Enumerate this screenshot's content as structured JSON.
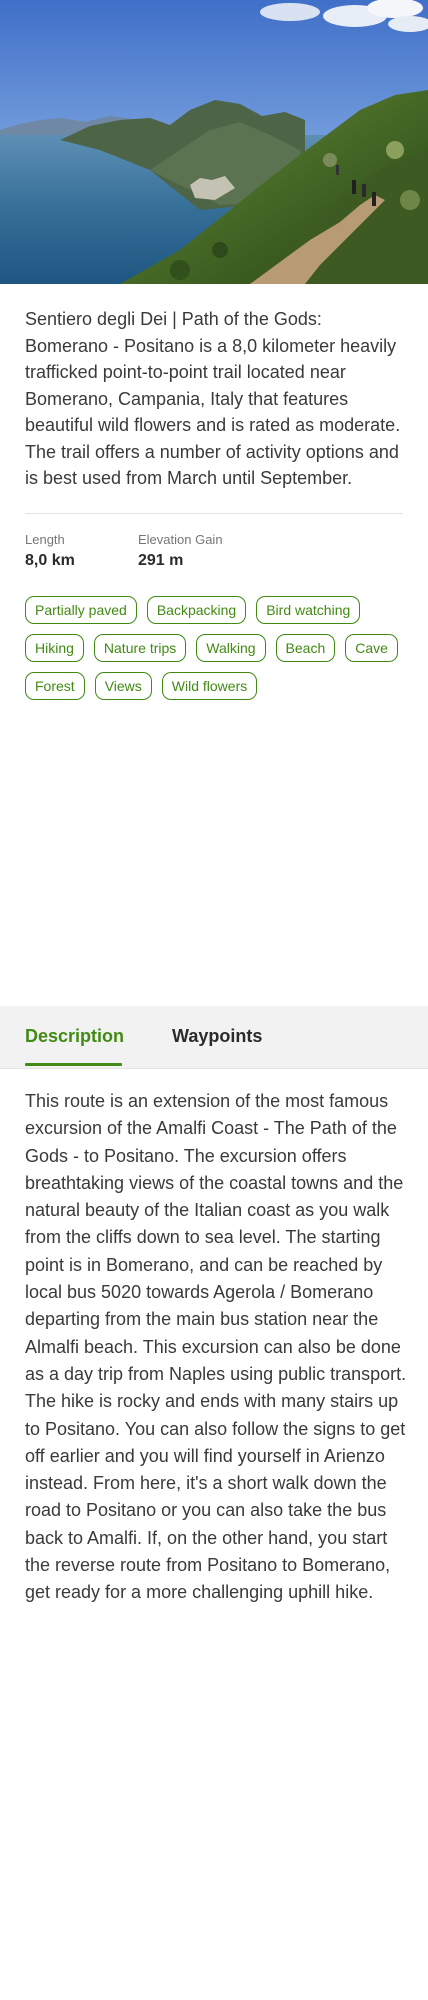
{
  "hero": {
    "alt": "Path of the Gods coastal view"
  },
  "summary": {
    "text": "Sentiero degli Dei | Path of the Gods: Bomerano - Positano is a 8,0 kilometer heavily trafficked point-to-point trail located near Bomerano, Campania, Italy that features beautiful wild flowers and is rated as moderate. The trail offers a number of activity options and is best used from March until September."
  },
  "stats": {
    "length_label": "Length",
    "length_value": "8,0 km",
    "elevation_label": "Elevation Gain",
    "elevation_value": "291 m"
  },
  "tags": [
    "Partially paved",
    "Backpacking",
    "Bird watching",
    "Hiking",
    "Nature trips",
    "Walking",
    "Beach",
    "Cave",
    "Forest",
    "Views",
    "Wild flowers"
  ],
  "tabs": {
    "description_label": "Description",
    "waypoints_label": "Waypoints",
    "active": "Description"
  },
  "description": {
    "text": "This route is an extension of the most famous excursion of the Amalfi Coast - The Path of the Gods - to Positano. The excursion offers breathtaking views of the coastal towns and the natural beauty of the Italian coast as you walk from the cliffs down to sea level. The starting point is in Bomerano, and can be reached by local bus 5020 towards Agerola / Bomerano departing from the main bus station near the Almalfi beach. This excursion can also be done as a day trip from Naples using public transport. The hike is rocky and ends with many stairs up to Positano. You can also follow the signs to get off earlier and you will find yourself in Arienzo instead. From here, it's a short walk down the road to Positano or you can also take the bus back to Amalfi. If, on the other hand, you start the reverse route from Positano to Bomerano, get ready for a more challenging uphill hike."
  },
  "colors": {
    "accent": "#428a13",
    "tab_bar_bg": "#f2f2f2",
    "text": "#3a3a3a"
  }
}
